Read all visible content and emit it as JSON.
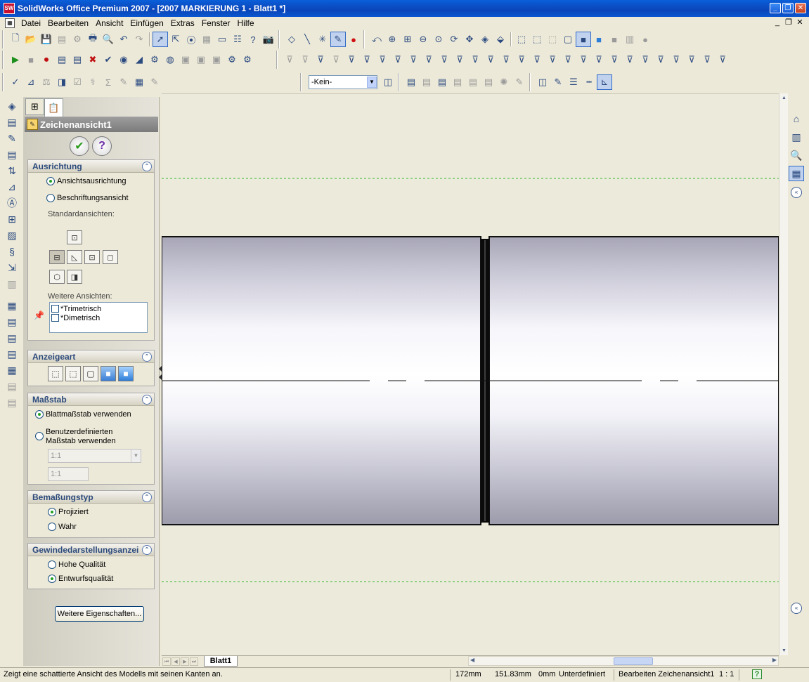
{
  "window": {
    "title": "SolidWorks Office Premium 2007 - [2007 MARKIERUNG 1 - Blatt1 *]",
    "app_icon_text": "SW"
  },
  "menu": {
    "items": [
      "Datei",
      "Bearbeiten",
      "Ansicht",
      "Einfügen",
      "Extras",
      "Fenster",
      "Hilfe"
    ]
  },
  "toolbar": {
    "layer_select_value": "-Kein-"
  },
  "property_manager": {
    "title": "Zeichenansicht1",
    "groups": {
      "orientation": {
        "title": "Ausrichtung",
        "option_view_orientation": "Ansichtsausrichtung",
        "option_annotation_view": "Beschriftungsansicht",
        "standard_views_label": "Standardansichten:",
        "more_views_label": "Weitere Ansichten:",
        "more_views": [
          "*Trimetrisch",
          "*Dimetrisch"
        ]
      },
      "display_style": {
        "title": "Anzeigeart"
      },
      "scale": {
        "title": "Maßstab",
        "option_sheet_scale": "Blattmaßstab verwenden",
        "option_custom_scale_line1": "Benutzerdefinierten",
        "option_custom_scale_line2": "Maßstab verwenden",
        "scale_combo_value": "1:1",
        "scale_text_value": "1:1"
      },
      "dimension_type": {
        "title": "Bemaßungstyp",
        "option_projected": "Projiziert",
        "option_true": "Wahr"
      },
      "thread_display": {
        "title": "Gewindedarstellungsanzei",
        "option_high_quality": "Hohe Qualität",
        "option_draft_quality": "Entwurfsqualität"
      }
    },
    "more_properties_button": "Weitere Eigenschaften..."
  },
  "sheet_tabs": [
    "Blatt1"
  ],
  "status_bar": {
    "hint": "Zeigt eine schattierte Ansicht des Modells mit seinen Kanten an.",
    "x": "172mm",
    "y": "151.83mm",
    "z": "0mm",
    "state": "Unterdefiniert",
    "mode": "Bearbeiten Zeichenansicht1",
    "scale": "1 : 1",
    "help_icon": "?"
  }
}
